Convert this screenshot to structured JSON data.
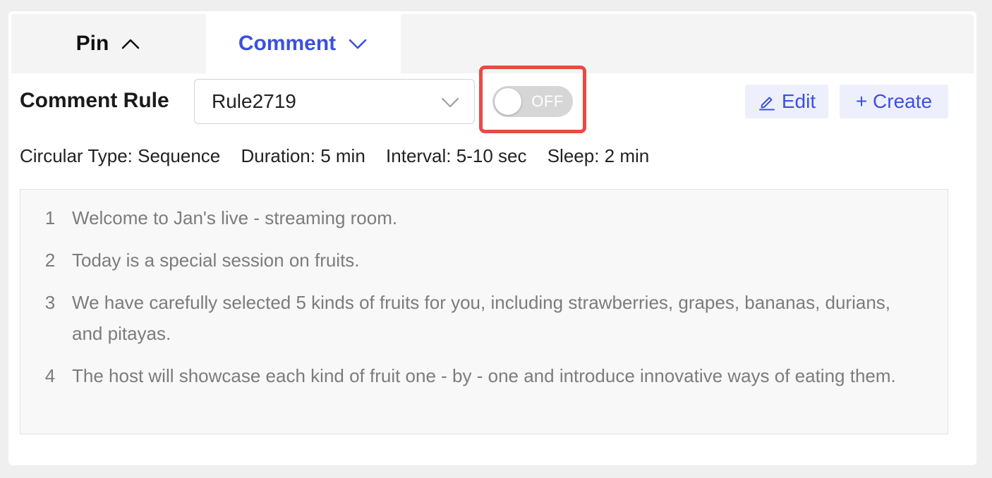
{
  "tabs": [
    {
      "label": "Pin",
      "icon": "chevron-up-icon",
      "active": false
    },
    {
      "label": "Comment",
      "icon": "chevron-down-icon",
      "active": true
    }
  ],
  "rule": {
    "label": "Comment Rule",
    "selected": "Rule2719",
    "toggle_text": "OFF",
    "toggle_state": "off"
  },
  "actions": {
    "edit_label": "Edit",
    "create_label": "+ Create"
  },
  "meta": {
    "circular_type": "Circular Type: Sequence",
    "duration": "Duration: 5 min",
    "interval": "Interval: 5-10 sec",
    "sleep": "Sleep: 2 min"
  },
  "comments": [
    {
      "num": "1",
      "text": "Welcome to Jan's live - streaming room."
    },
    {
      "num": "2",
      "text": "Today is a special session on fruits."
    },
    {
      "num": "3",
      "text": "We have carefully selected 5 kinds of fruits for you, including strawberries, grapes, bananas, durians, and pitayas."
    },
    {
      "num": "4",
      "text": "The host will showcase each kind of fruit one - by - one and introduce innovative ways of eating them."
    }
  ],
  "colors": {
    "accent": "#3c50e0",
    "accent_bg": "#edf0fc",
    "highlight": "#e84a45",
    "toggle_off": "#d6d6d6"
  }
}
